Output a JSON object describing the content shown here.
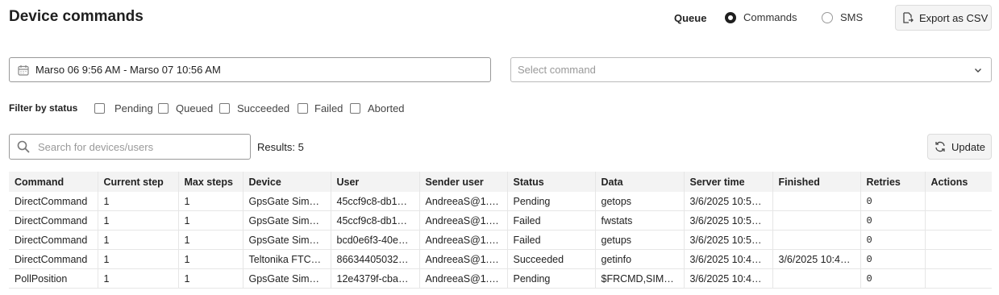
{
  "header": {
    "title": "Device commands",
    "queue_label": "Queue",
    "queue_options": [
      {
        "label": "Commands",
        "selected": true
      },
      {
        "label": "SMS",
        "selected": false
      }
    ],
    "export_label": "Export as CSV",
    "export_icon": "export-file-icon"
  },
  "filters": {
    "date_range": "Marso 06 9:56 AM - Marso 07 10:56 AM",
    "date_icon": "calendar-icon",
    "command_placeholder": "Select command",
    "status_label": "Filter by status",
    "statuses": [
      {
        "label": "Pending",
        "checked": false
      },
      {
        "label": "Queued",
        "checked": false
      },
      {
        "label": "Succeeded",
        "checked": false
      },
      {
        "label": "Failed",
        "checked": false
      },
      {
        "label": "Aborted",
        "checked": false
      }
    ]
  },
  "search": {
    "placeholder": "Search for devices/users",
    "value": ""
  },
  "results_text": "Results: 5",
  "update_label": "Update",
  "table": {
    "columns": [
      "Command",
      "Current step",
      "Max steps",
      "Device",
      "User",
      "Sender user",
      "Status",
      "Data",
      "Server time",
      "Finished",
      "Retries",
      "Actions"
    ],
    "rows": [
      [
        "DirectCommand",
        "1",
        "1",
        "GpsGate Simul…",
        "45ccf9c8-db1…",
        "AndreeaS@1. S…",
        "Pending",
        "getops",
        "3/6/2025 10:5…",
        "",
        "0",
        ""
      ],
      [
        "DirectCommand",
        "1",
        "1",
        "GpsGate Simul…",
        "45ccf9c8-db1…",
        "AndreeaS@1. S…",
        "Failed",
        "fwstats",
        "3/6/2025 10:5…",
        "",
        "0",
        ""
      ],
      [
        "DirectCommand",
        "1",
        "1",
        "GpsGate Simul…",
        "bcd0e6f3-40e…",
        "AndreeaS@1. S…",
        "Failed",
        "getups",
        "3/6/2025 10:5…",
        "",
        "0",
        ""
      ],
      [
        "DirectCommand",
        "1",
        "1",
        "Teltonika FTC9…",
        "86634405032…",
        "AndreeaS@1. S…",
        "Succeeded",
        "getinfo",
        "3/6/2025 10:4…",
        "3/6/2025 10:4…",
        "0",
        ""
      ],
      [
        "PollPosition",
        "1",
        "1",
        "GpsGate Simul…",
        "12e4379f-cba…",
        "AndreeaS@1. S…",
        "Pending",
        "$FRCMD,SIM0…",
        "3/6/2025 10:4…",
        "",
        "0",
        ""
      ]
    ]
  }
}
